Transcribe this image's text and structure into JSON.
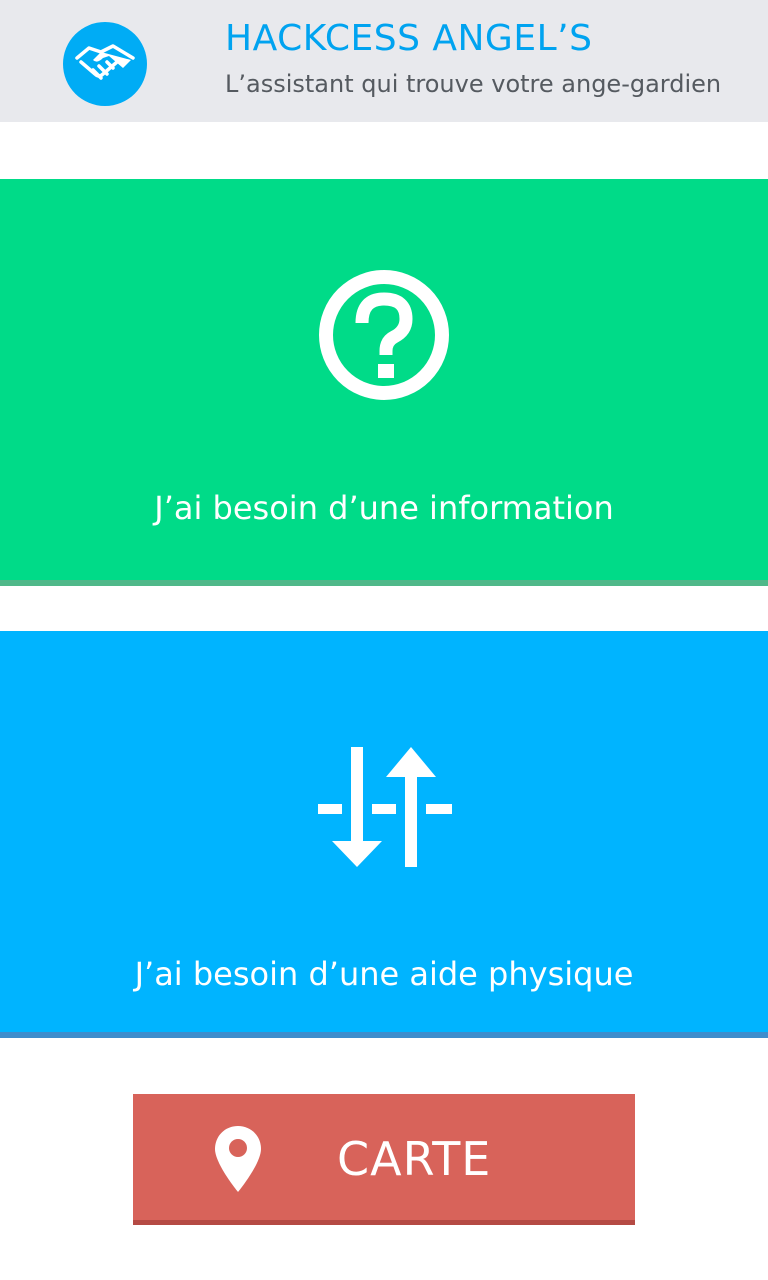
{
  "header": {
    "title": "HACKCESS ANGEL’S",
    "subtitle": "L’assistant qui trouve votre ange-gardien",
    "logo_icon": "handshake-icon"
  },
  "cards": [
    {
      "label": "J’ai besoin d’une information",
      "icon": "question-circle-icon",
      "color": "#00db88"
    },
    {
      "label": "J’ai besoin d’une aide physique",
      "icon": "up-down-arrows-icon",
      "color": "#00b4ff"
    }
  ],
  "map_button": {
    "label": "CARTE",
    "icon": "map-pin-icon",
    "color": "#d8635a"
  },
  "colors": {
    "header_bg": "#e8e9ed",
    "accent": "#00a3f0"
  }
}
